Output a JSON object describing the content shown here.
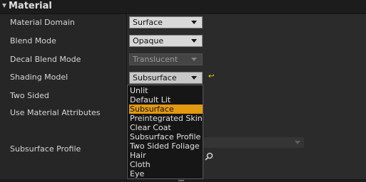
{
  "section": {
    "title": "Material"
  },
  "properties": [
    {
      "label": "Material Domain",
      "value": "Surface"
    },
    {
      "label": "Blend Mode",
      "value": "Opaque"
    },
    {
      "label": "Decal Blend Mode",
      "value": "Translucent"
    },
    {
      "label": "Shading Model",
      "value": "Subsurface"
    },
    {
      "label": "Two Sided"
    },
    {
      "label": "Use Material Attributes"
    },
    {
      "label": "Subsurface Profile"
    }
  ],
  "shading_model_options": [
    "Unlit",
    "Default Lit",
    "Subsurface",
    "Preintegrated Skin",
    "Clear Coat",
    "Subsurface Profile",
    "Two Sided Foliage",
    "Hair",
    "Cloth",
    "Eye"
  ],
  "selected_option": "Subsurface",
  "colors": {
    "highlight": "#e39a10",
    "reset_arrow": "#e8e000"
  }
}
